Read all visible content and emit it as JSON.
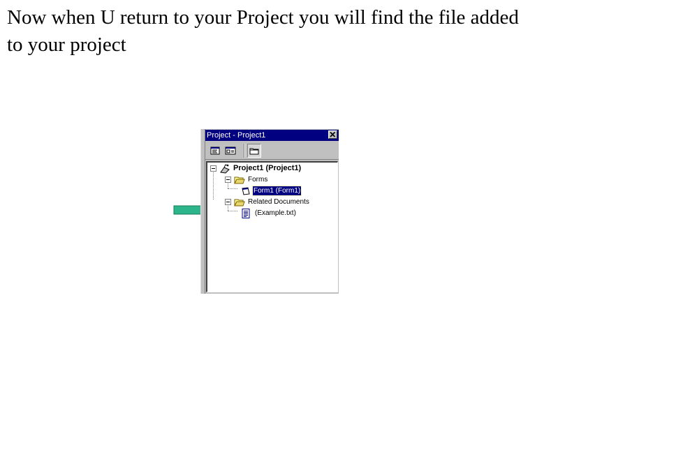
{
  "caption": {
    "line1": "Now when U return to your Project you will find the file added",
    "line2": "to your project"
  },
  "arrow": {
    "color": "#2cb58a"
  },
  "project_window": {
    "title": "Project - Project1",
    "toolbar": {
      "buttons": [
        {
          "icon": "view-code-icon"
        },
        {
          "icon": "view-object-icon"
        },
        {
          "icon": "toggle-folders-icon",
          "pressed": true
        }
      ]
    },
    "tree": {
      "root": "Project1 (Project1)",
      "forms_folder": "Forms",
      "form_item": "Form1 (Form1)",
      "related_folder": "Related Documents",
      "document_item": "(Example.txt)"
    }
  },
  "colors": {
    "titlebar": "#000080",
    "selection": "#000080",
    "chrome": "#c0c0c0"
  }
}
